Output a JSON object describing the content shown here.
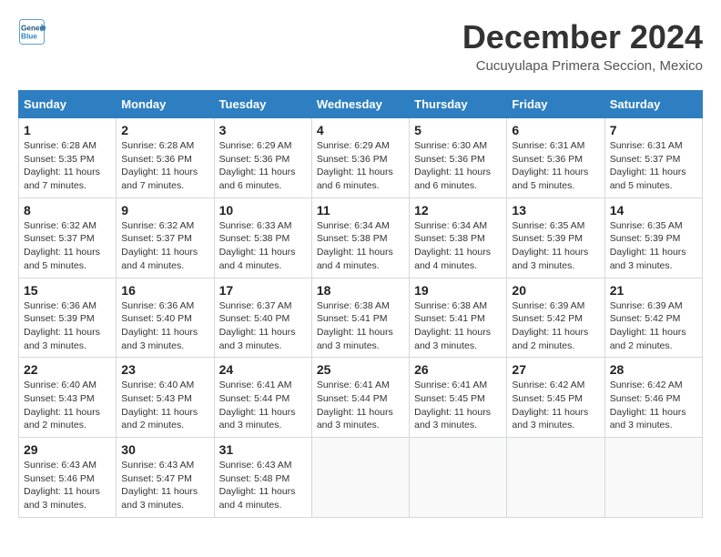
{
  "header": {
    "logo_line1": "General",
    "logo_line2": "Blue",
    "title": "December 2024",
    "subtitle": "Cucuyulapa Primera Seccion, Mexico"
  },
  "weekdays": [
    "Sunday",
    "Monday",
    "Tuesday",
    "Wednesday",
    "Thursday",
    "Friday",
    "Saturday"
  ],
  "weeks": [
    [
      {
        "day": "1",
        "sunrise": "6:28 AM",
        "sunset": "5:35 PM",
        "daylight": "11 hours and 7 minutes."
      },
      {
        "day": "2",
        "sunrise": "6:28 AM",
        "sunset": "5:36 PM",
        "daylight": "11 hours and 7 minutes."
      },
      {
        "day": "3",
        "sunrise": "6:29 AM",
        "sunset": "5:36 PM",
        "daylight": "11 hours and 6 minutes."
      },
      {
        "day": "4",
        "sunrise": "6:29 AM",
        "sunset": "5:36 PM",
        "daylight": "11 hours and 6 minutes."
      },
      {
        "day": "5",
        "sunrise": "6:30 AM",
        "sunset": "5:36 PM",
        "daylight": "11 hours and 6 minutes."
      },
      {
        "day": "6",
        "sunrise": "6:31 AM",
        "sunset": "5:36 PM",
        "daylight": "11 hours and 5 minutes."
      },
      {
        "day": "7",
        "sunrise": "6:31 AM",
        "sunset": "5:37 PM",
        "daylight": "11 hours and 5 minutes."
      }
    ],
    [
      {
        "day": "8",
        "sunrise": "6:32 AM",
        "sunset": "5:37 PM",
        "daylight": "11 hours and 5 minutes."
      },
      {
        "day": "9",
        "sunrise": "6:32 AM",
        "sunset": "5:37 PM",
        "daylight": "11 hours and 4 minutes."
      },
      {
        "day": "10",
        "sunrise": "6:33 AM",
        "sunset": "5:38 PM",
        "daylight": "11 hours and 4 minutes."
      },
      {
        "day": "11",
        "sunrise": "6:34 AM",
        "sunset": "5:38 PM",
        "daylight": "11 hours and 4 minutes."
      },
      {
        "day": "12",
        "sunrise": "6:34 AM",
        "sunset": "5:38 PM",
        "daylight": "11 hours and 4 minutes."
      },
      {
        "day": "13",
        "sunrise": "6:35 AM",
        "sunset": "5:39 PM",
        "daylight": "11 hours and 3 minutes."
      },
      {
        "day": "14",
        "sunrise": "6:35 AM",
        "sunset": "5:39 PM",
        "daylight": "11 hours and 3 minutes."
      }
    ],
    [
      {
        "day": "15",
        "sunrise": "6:36 AM",
        "sunset": "5:39 PM",
        "daylight": "11 hours and 3 minutes."
      },
      {
        "day": "16",
        "sunrise": "6:36 AM",
        "sunset": "5:40 PM",
        "daylight": "11 hours and 3 minutes."
      },
      {
        "day": "17",
        "sunrise": "6:37 AM",
        "sunset": "5:40 PM",
        "daylight": "11 hours and 3 minutes."
      },
      {
        "day": "18",
        "sunrise": "6:38 AM",
        "sunset": "5:41 PM",
        "daylight": "11 hours and 3 minutes."
      },
      {
        "day": "19",
        "sunrise": "6:38 AM",
        "sunset": "5:41 PM",
        "daylight": "11 hours and 3 minutes."
      },
      {
        "day": "20",
        "sunrise": "6:39 AM",
        "sunset": "5:42 PM",
        "daylight": "11 hours and 2 minutes."
      },
      {
        "day": "21",
        "sunrise": "6:39 AM",
        "sunset": "5:42 PM",
        "daylight": "11 hours and 2 minutes."
      }
    ],
    [
      {
        "day": "22",
        "sunrise": "6:40 AM",
        "sunset": "5:43 PM",
        "daylight": "11 hours and 2 minutes."
      },
      {
        "day": "23",
        "sunrise": "6:40 AM",
        "sunset": "5:43 PM",
        "daylight": "11 hours and 2 minutes."
      },
      {
        "day": "24",
        "sunrise": "6:41 AM",
        "sunset": "5:44 PM",
        "daylight": "11 hours and 3 minutes."
      },
      {
        "day": "25",
        "sunrise": "6:41 AM",
        "sunset": "5:44 PM",
        "daylight": "11 hours and 3 minutes."
      },
      {
        "day": "26",
        "sunrise": "6:41 AM",
        "sunset": "5:45 PM",
        "daylight": "11 hours and 3 minutes."
      },
      {
        "day": "27",
        "sunrise": "6:42 AM",
        "sunset": "5:45 PM",
        "daylight": "11 hours and 3 minutes."
      },
      {
        "day": "28",
        "sunrise": "6:42 AM",
        "sunset": "5:46 PM",
        "daylight": "11 hours and 3 minutes."
      }
    ],
    [
      {
        "day": "29",
        "sunrise": "6:43 AM",
        "sunset": "5:46 PM",
        "daylight": "11 hours and 3 minutes."
      },
      {
        "day": "30",
        "sunrise": "6:43 AM",
        "sunset": "5:47 PM",
        "daylight": "11 hours and 3 minutes."
      },
      {
        "day": "31",
        "sunrise": "6:43 AM",
        "sunset": "5:48 PM",
        "daylight": "11 hours and 4 minutes."
      },
      null,
      null,
      null,
      null
    ]
  ]
}
